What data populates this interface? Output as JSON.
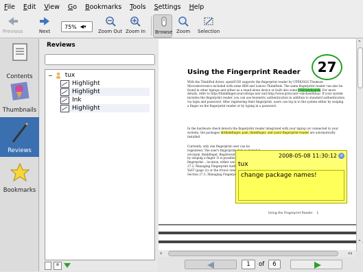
{
  "menu": [
    "File",
    "Edit",
    "View",
    "Go",
    "Bookmarks",
    "Tools",
    "Settings",
    "Help"
  ],
  "toolbar": {
    "previous": "Previous",
    "next": "Next",
    "zoom_value": "75%",
    "zoom_out": "Zoom Out",
    "zoom_in": "Zoom In",
    "browse": "Browse",
    "zoom": "Zoom",
    "selection": "Selection"
  },
  "sidebar": {
    "contents": "Contents",
    "thumbnails": "Thumbnails",
    "reviews": "Reviews",
    "bookmarks": "Bookmarks"
  },
  "panel": {
    "title": "Reviews",
    "author": "tux",
    "items": [
      "Highlight",
      "Highlight",
      "Ink",
      "Highlight"
    ]
  },
  "document": {
    "title": "Using the Fingerprint Reader",
    "page_number_circled": "27",
    "paragraph1": "With the ThinkPad driver, openSUSE supports the fingerprint reader by UPEK/SGS Thomson Microelectronics included with some IBM and Lenovo ThinkPads. The same fingerprint reader can also be found in other laptops and either as a stand-alone device or built into some",
    "paragraph1_highlight_green": "USB keyboards",
    "paragraph1_rest": ". For more details, refer to http://thinkfinger.sourceforge.net/ and http://www.qrivy.net/~michael/blua/. If your system includes the fingerprint reader, you can use biometric authentication in addition to standard authentication via login and password. After registering their fingerprint, users can log in to the system either by swiping a finger on the fingerprint reader or by typing in a password.",
    "paragraph2": "In the hardware check detects the fingerprint reader integrated with your laptop (or connected to your system), the packages",
    "paragraph2_highlight": "libthinkfinger, pam_thinkfinger, and yast2-fingerprint-reader",
    "paragraph2_rest": "are automatically installed.",
    "paragraph3": "Currently, only one fingerprint user can be registered. The user's fingerprint data is stored in /etc/pam_thinkfinger. Registered users can log in by swiping a finger. It is possible to use fingerprint... location, either use YaST (see Section 27.2, Managing Fingerprint Authentication with YaST (page 2)) or the tf-tool command line tool (see Section 27.3, Managing Fingerprint ...",
    "footer": "Using the Fingerprint Reader",
    "footer_page": "1"
  },
  "note": {
    "date": "2008-05-08 11:30:12",
    "author": "tux",
    "body": "change package names!"
  },
  "navigation": {
    "current_page": "1",
    "of": "of",
    "total_pages": "6"
  }
}
